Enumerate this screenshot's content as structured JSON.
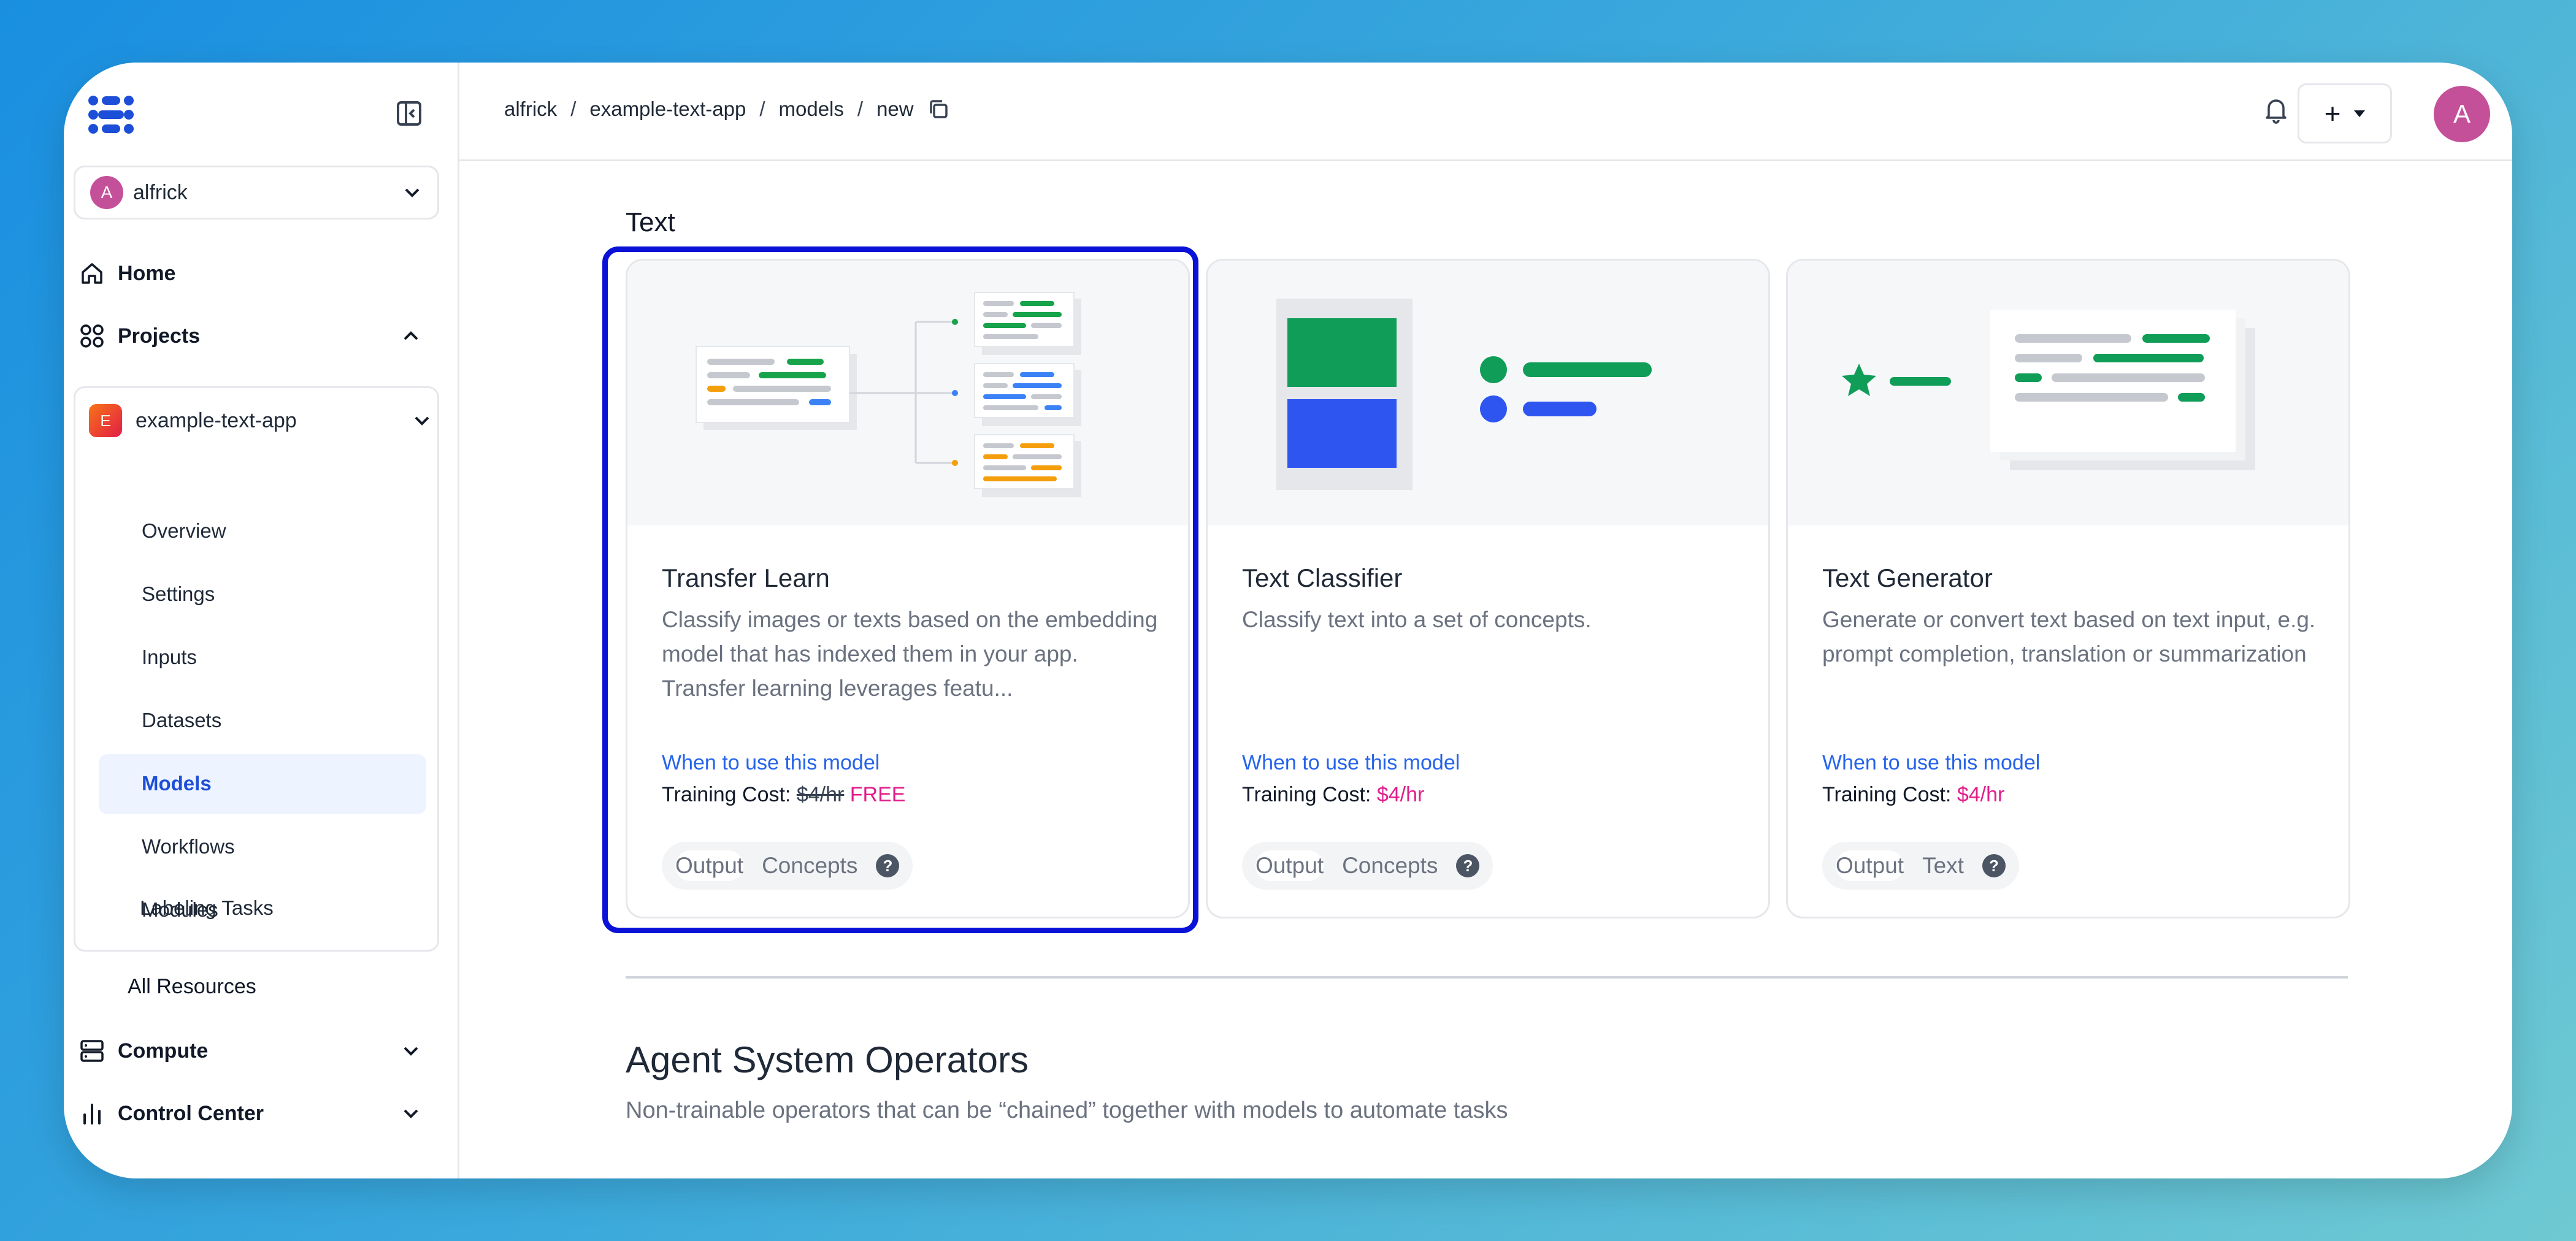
{
  "sidebar": {
    "org": {
      "avatar_letter": "A",
      "name": "alfrick"
    },
    "home_label": "Home",
    "projects_label": "Projects",
    "project": {
      "badge": "E",
      "name": "example-text-app"
    },
    "sub_items": [
      "Overview",
      "Settings",
      "Inputs",
      "Datasets",
      "Models",
      "Workflows",
      "Modules",
      "Labeling Tasks"
    ],
    "active_sub_item": "Models",
    "all_resources_label": "All Resources",
    "compute_label": "Compute",
    "control_center_label": "Control Center"
  },
  "topbar": {
    "breadcrumbs": [
      "alfrick",
      "example-text-app",
      "models",
      "new"
    ],
    "separator": "/",
    "add_symbol": "+",
    "avatar_letter": "A"
  },
  "main": {
    "section_title": "Text",
    "cards": [
      {
        "title": "Transfer Learn",
        "description": "Classify images or texts based on the embedding model that has indexed them in your app. Transfer learning leverages featu...",
        "when_link": "When to use this model",
        "cost_label": "Training Cost:",
        "cost_old": "$4/hr",
        "cost_value": "FREE",
        "tags": [
          "Output",
          "Concepts"
        ],
        "selected": true
      },
      {
        "title": "Text Classifier",
        "description": "Classify text into a set of concepts.",
        "when_link": "When to use this model",
        "cost_label": "Training Cost:",
        "cost_value": "$4/hr",
        "tags": [
          "Output",
          "Concepts"
        ]
      },
      {
        "title": "Text Generator",
        "description": "Generate or convert text based on text input, e.g. prompt completion, translation or summarization",
        "when_link": "When to use this model",
        "cost_label": "Training Cost:",
        "cost_value": "$4/hr",
        "tags": [
          "Output",
          "Text"
        ]
      }
    ],
    "agent_section": {
      "title": "Agent System Operators",
      "subtitle": "Non-trainable operators that can be “chained” together with models to automate tasks"
    }
  },
  "colors": {
    "accent_blue": "#2563eb",
    "selection_outline": "#0a12d8",
    "pink": "#e11d8a",
    "green": "#0f9d58",
    "avatar": "#c5509a"
  }
}
